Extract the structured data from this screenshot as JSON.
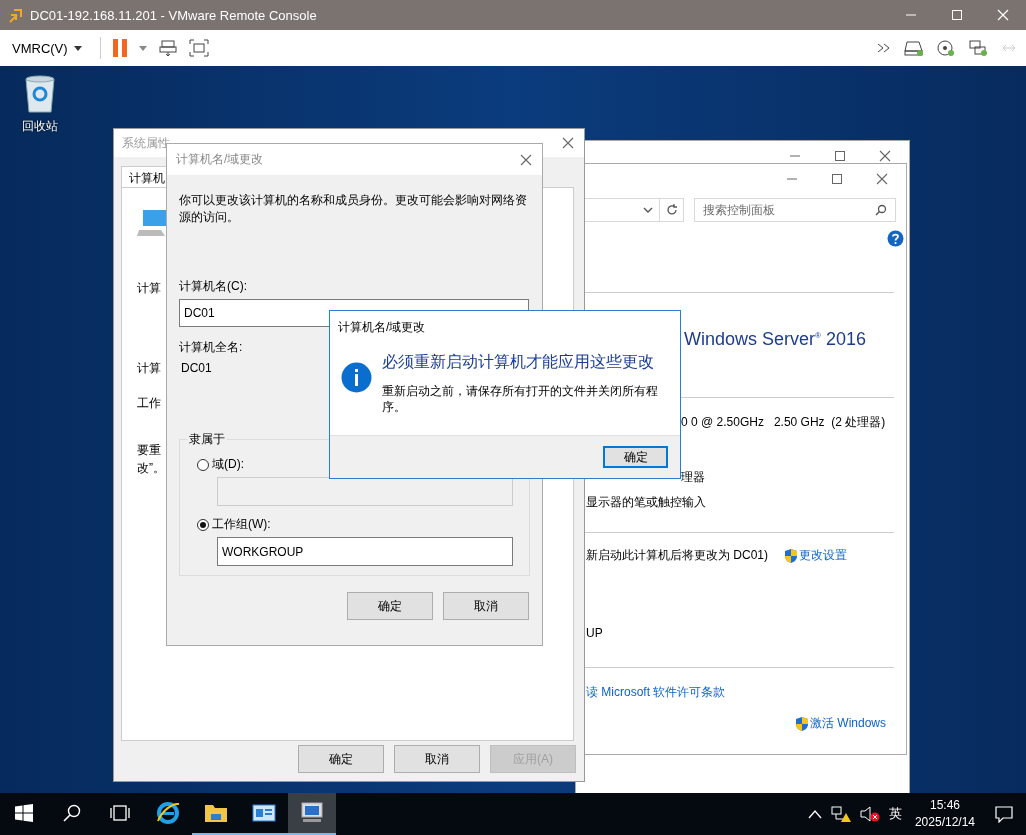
{
  "app": {
    "title": "DC01-192.168.11.201 - VMware Remote Console",
    "menu": "VMRC(V)"
  },
  "desktop_icons": [
    {
      "label": "回收站"
    }
  ],
  "system_properties": {
    "title": "系统属性",
    "tab": "计算机",
    "labels": [
      "计算",
      "计算",
      "工作",
      "要重",
      "改”。"
    ],
    "buttons": [
      {
        "label": "确定",
        "disabled": false
      },
      {
        "label": "取消",
        "disabled": false
      },
      {
        "label": "应用(A)",
        "disabled": true
      }
    ]
  },
  "control_panel": {
    "search": {
      "placeholder": "搜索控制面板"
    },
    "sections": [
      {
        "rows": [
          [
            {
              "kind": "title",
              "text": "Windows Server$^{®}$ 2016"
            }
          ]
        ]
      },
      {
        "rows": [
          [
            {
              "kind": "text",
              "text": "0 0 @ 2.50GHz   2.50 GHz  (2 处理器)"
            }
          ],
          [
            {
              "kind": "text",
              "text": "理器"
            }
          ],
          [
            {
              "kind": "text",
              "text": "显示器的笔或触控输入"
            }
          ]
        ]
      },
      {
        "rows": [
          [
            {
              "kind": "text",
              "text": "新启动此计算机后将更改为 DC01)"
            },
            {
              "kind": "shield_link",
              "text": "更改设置"
            }
          ],
          [
            {
              "kind": "text",
              "text": "UP"
            }
          ]
        ]
      },
      {
        "rows": [
          [
            {
              "kind": "link",
              "text": "读 Microsoft 软件许可条款"
            }
          ],
          [
            {
              "kind": "shield_link",
              "text": "激活 Windows"
            }
          ]
        ]
      }
    ]
  },
  "name_dialog": {
    "title": "计算机名/域更改",
    "description": "你可以更改该计算机的名称和成员身份。更改可能会影响对网络资源的访问。",
    "name_label": "计算机名(C):",
    "name_value": "DC01",
    "full_name_label": "计算机全名:",
    "full_name": "DC01",
    "member_of": {
      "legend": "隶属于",
      "options": [
        {
          "label": "域(D):",
          "selected": false
        },
        {
          "label": "工作组(W):",
          "selected": true,
          "value": "WORKGROUP"
        }
      ]
    },
    "buttons": [
      "确定",
      "取消"
    ]
  },
  "message_box": {
    "title": "计算机名/域更改",
    "heading": "必须重新启动计算机才能应用这些更改",
    "body": "重新启动之前，请保存所有打开的文件并关闭所有程序。",
    "button": "确定"
  },
  "taskbar": {
    "apps": [
      {
        "kind": "browser",
        "running": false,
        "active": false
      },
      {
        "kind": "folder",
        "running": true,
        "active": false
      },
      {
        "kind": "server",
        "running": true,
        "active": false
      },
      {
        "kind": "monitor",
        "running": true,
        "active": true
      }
    ],
    "tray": {
      "ime": "英",
      "time": "15:46",
      "date": "2025/12/14"
    }
  }
}
